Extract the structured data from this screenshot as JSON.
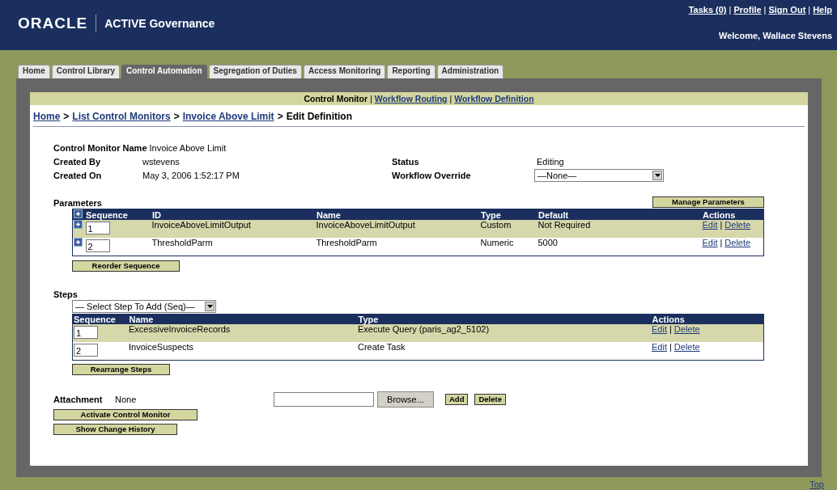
{
  "header": {
    "logo": "ORACLE",
    "product": "ACTIVE Governance",
    "links": [
      "Tasks (0)",
      "Profile",
      "Sign Out",
      "Help"
    ],
    "separator": "|",
    "welcome": "Welcome, Wallace Stevens"
  },
  "tabs": [
    {
      "label": "Home",
      "selected": false
    },
    {
      "label": "Control Library",
      "selected": false
    },
    {
      "label": "Control Automation",
      "selected": true
    },
    {
      "label": "Segregation of Duties",
      "selected": false
    },
    {
      "label": "Access Monitoring",
      "selected": false
    },
    {
      "label": "Reporting",
      "selected": false
    },
    {
      "label": "Administration",
      "selected": false
    }
  ],
  "subnav_separator": "|",
  "subnav": [
    {
      "label": "Control Monitor",
      "selected": true
    },
    {
      "label": "Workflow Routing",
      "selected": false
    },
    {
      "label": "Workflow Definition",
      "selected": false
    }
  ],
  "breadcrumb": {
    "separator": ">",
    "links": [
      "Home",
      "List Control Monitors",
      "Invoice Above Limit"
    ],
    "current": "Edit Definition"
  },
  "info": {
    "name_label": "Control Monitor Name",
    "name": "Invoice Above Limit",
    "created_by_label": "Created By",
    "created_by": "wstevens",
    "created_on_label": "Created On",
    "created_on": "May 3, 2006 1:52:17 PM",
    "status_label": "Status",
    "status": "Editing",
    "override_label": "Workflow Override",
    "override": "—None—"
  },
  "action_separator": "|",
  "parameters": {
    "title": "Parameters",
    "manage_button": "Manage Parameters",
    "columns": [
      "Sequence",
      "ID",
      "Name",
      "Type",
      "Default",
      "Actions"
    ],
    "rows": [
      {
        "sequence": "1",
        "id": "InvoiceAboveLimitOutput",
        "name": "InvoiceAboveLimitOutput",
        "type": "Custom",
        "default": "Not Required",
        "actions": [
          "Edit",
          "Delete"
        ]
      },
      {
        "sequence": "2",
        "id": "ThresholdParm",
        "name": "ThresholdParm",
        "type": "Numeric",
        "default": "5000",
        "actions": [
          "Edit",
          "Delete"
        ]
      }
    ],
    "reorder_button": "Reorder Sequence"
  },
  "steps": {
    "title": "Steps",
    "select": "— Select Step To Add (Seq)—",
    "columns": [
      "Sequence",
      "Name",
      "Type",
      "Actions"
    ],
    "rows": [
      {
        "sequence": "1",
        "name": "ExcessiveInvoiceRecords",
        "type": "Execute Query (paris_ag2_5102)",
        "actions": [
          "Edit",
          "Delete"
        ]
      },
      {
        "sequence": "2",
        "name": "InvoiceSuspects",
        "type": "Create Task",
        "actions": [
          "Edit",
          "Delete"
        ]
      }
    ],
    "rearrange_button": "Rearrange Steps"
  },
  "attachment": {
    "label": "Attachment",
    "value": "None",
    "browse_button": "Browse...",
    "add_button": "Add",
    "delete_button": "Delete"
  },
  "buttons": [
    "Activate Control Monitor",
    "Show Change History"
  ],
  "footer_link": "Top"
}
